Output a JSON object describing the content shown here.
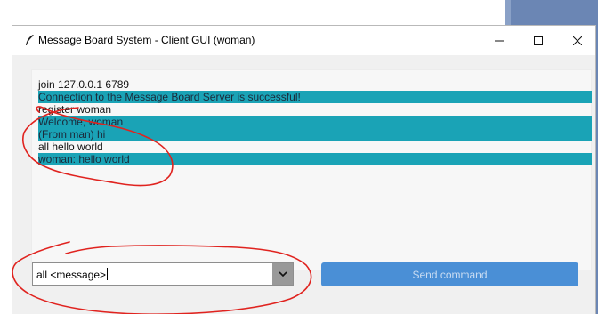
{
  "window": {
    "title": "Message Board System - Client GUI (woman)",
    "controls": {
      "minimize": "minimize-icon",
      "maximize": "maximize-icon",
      "close": "close-icon"
    }
  },
  "log": {
    "lines": [
      {
        "text": "join 127.0.0.1 6789",
        "highlighted": false
      },
      {
        "text": "Connection to the Message Board Server is successful!",
        "highlighted": true
      },
      {
        "text": "register woman",
        "highlighted": false
      },
      {
        "text": "Welcome, woman",
        "highlighted": true
      },
      {
        "text": "(From man) hi",
        "highlighted": true
      },
      {
        "text": "all hello world",
        "highlighted": false
      },
      {
        "text": "woman: hello world",
        "highlighted": true
      }
    ]
  },
  "command": {
    "value": "all <message>",
    "dropdown_icon": "chevron-down-icon"
  },
  "send_button": {
    "label": "Send command"
  },
  "colors": {
    "highlight": "#1aa3b6",
    "send_button": "#4a8fd6",
    "annotation": "#e0231f",
    "desktop": "#6b86b4"
  }
}
